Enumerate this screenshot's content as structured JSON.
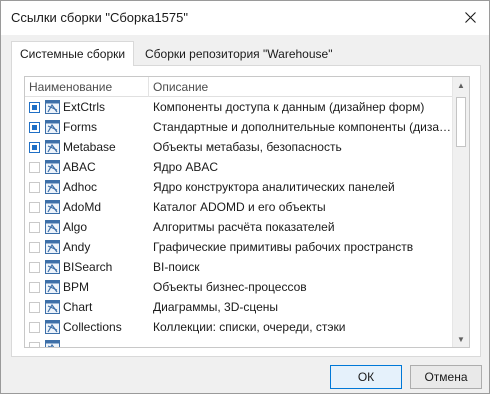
{
  "window": {
    "title": "Ссылки сборки \"Сборка1575\"",
    "close_icon": "close-icon"
  },
  "tabs": [
    {
      "label": "Системные сборки",
      "active": true
    },
    {
      "label": "Сборки репозитория \"Warehouse\"",
      "active": false
    }
  ],
  "table": {
    "columns": [
      "Наименование",
      "Описание"
    ],
    "rows": [
      {
        "name": "ExtCtrls",
        "description": "Компоненты доступа к данным (дизайнер форм)",
        "checked": true
      },
      {
        "name": "Forms",
        "description": "Стандартные и дополнительные компоненты (дизайне...",
        "checked": true
      },
      {
        "name": "Metabase",
        "description": "Объекты метабазы, безопасность",
        "checked": true
      },
      {
        "name": "ABAC",
        "description": "Ядро ABAC",
        "checked": false
      },
      {
        "name": "Adhoc",
        "description": "Ядро конструктора аналитических панелей",
        "checked": false
      },
      {
        "name": "AdoMd",
        "description": "Каталог ADOMD и его объекты",
        "checked": false
      },
      {
        "name": "Algo",
        "description": "Алгоритмы расчёта показателей",
        "checked": false
      },
      {
        "name": "Andy",
        "description": "Графические примитивы рабочих пространств",
        "checked": false
      },
      {
        "name": "BISearch",
        "description": "BI-поиск",
        "checked": false
      },
      {
        "name": "BPM",
        "description": "Объекты бизнес-процессов",
        "checked": false
      },
      {
        "name": "Chart",
        "description": "Диаграммы, 3D-сцены",
        "checked": false
      },
      {
        "name": "Collections",
        "description": "Коллекции: списки, очереди, стэки",
        "checked": false
      },
      {
        "name": "",
        "description": "",
        "checked": false
      }
    ]
  },
  "buttons": {
    "ok": "ОК",
    "cancel": "Отмена"
  },
  "colors": {
    "accent": "#1f6fc5",
    "icon": "#3d6fa8"
  }
}
